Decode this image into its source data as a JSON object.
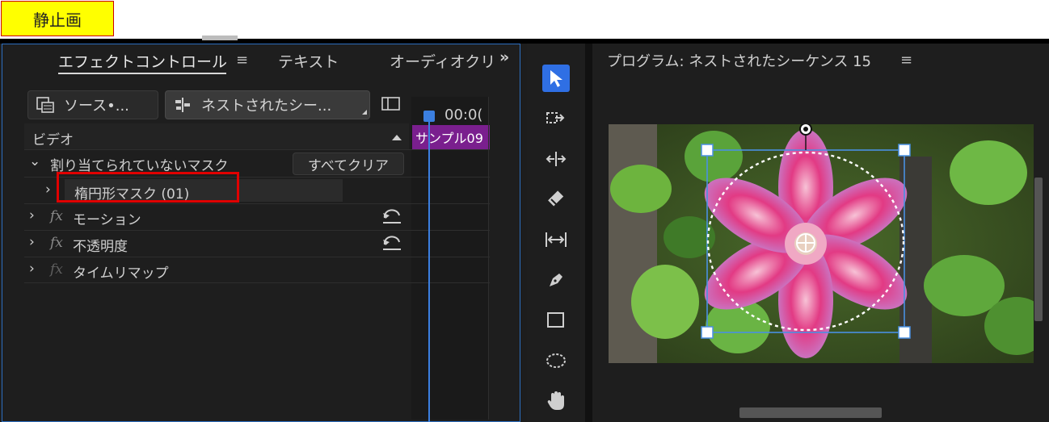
{
  "label_tag": "静止画",
  "effect_panel": {
    "tabs": [
      {
        "label": "エフェクトコントロール",
        "active": true
      },
      {
        "label": "テキスト",
        "active": false
      },
      {
        "label": "オーディオクリ",
        "active": false
      }
    ],
    "overflow_icon": "»",
    "menu_icon": "≡",
    "source_button": "ソース•...",
    "sequence_button": "ネストされたシー...",
    "timecode": "00:0(",
    "section_header": "ビデオ",
    "clip_label": "サンプル09",
    "mask_group": "割り当てられていないマスク",
    "clear_all_button": "すべてクリア",
    "mask_item": "楕円形マスク (01)",
    "effects": [
      {
        "fx": "fx",
        "label": "モーション"
      },
      {
        "fx": "fx",
        "label": "不透明度"
      },
      {
        "fx": "fx",
        "label": "タイムリマップ"
      }
    ]
  },
  "program_monitor": {
    "title": "プログラム: ネストされたシーケンス 15",
    "menu_icon": "≡"
  },
  "tools": [
    "selection-tool",
    "track-select-tool",
    "ripple-edit-tool",
    "razor-tool",
    "slip-tool",
    "pen-tool",
    "rectangle-tool",
    "ellipse-tool",
    "hand-tool"
  ],
  "colors": {
    "accent": "#2f6fe4",
    "highlight_box": "#e00000",
    "clip": "#7a1f8e",
    "tag_bg": "#ffff00"
  }
}
